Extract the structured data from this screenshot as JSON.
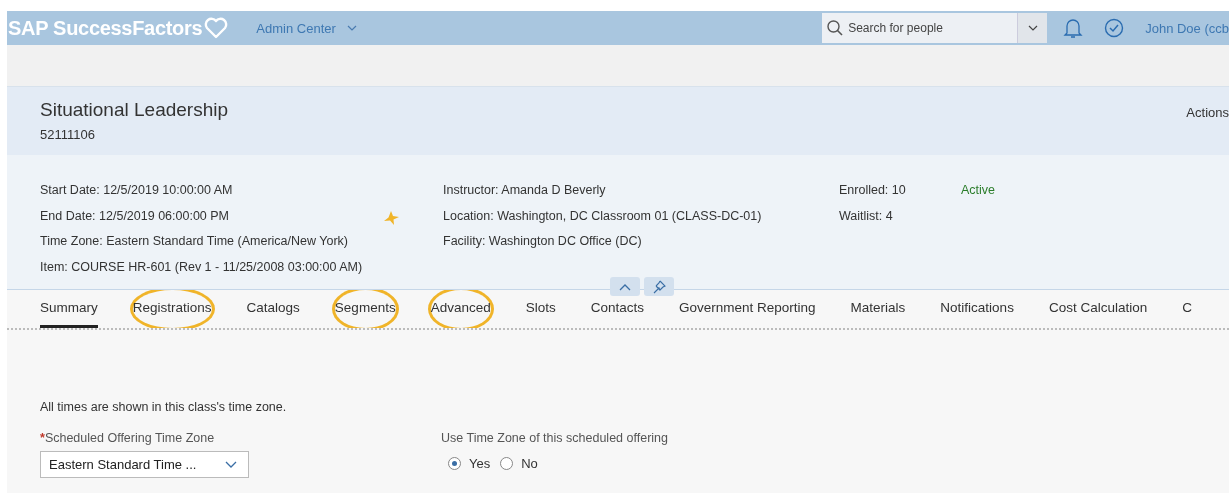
{
  "header": {
    "logo": "SAP SuccessFactors",
    "module": "Admin Center",
    "search": {
      "placeholder": "Search for people"
    },
    "user": "John Doe (ccb"
  },
  "title_panel": {
    "title": "Situational Leadership",
    "id": "52111106",
    "actions": "Actions"
  },
  "details": {
    "columns": [
      [
        "Start Date: 12/5/2019 10:00:00 AM",
        "End Date: 12/5/2019 06:00:00 PM",
        "Time Zone: Eastern Standard Time (America/New York)",
        "Item: COURSE HR-601 (Rev 1 - 11/25/2008 03:00:00 AM)"
      ],
      [
        "Instructor: Amanda D Beverly",
        "Location: Washington, DC Classroom 01 (CLASS-DC-01)",
        "Facility: Washington DC Office (DC)"
      ],
      [
        "Enrolled: 10",
        "Waitlist: 4"
      ]
    ],
    "status": {
      "text": "Active",
      "kind": "active"
    }
  },
  "tabs": [
    {
      "label": "Summary",
      "selected": true,
      "highlighted": false
    },
    {
      "label": "Registrations",
      "selected": false,
      "highlighted": true
    },
    {
      "label": "Catalogs",
      "selected": false,
      "highlighted": false
    },
    {
      "label": "Segments",
      "selected": false,
      "highlighted": true
    },
    {
      "label": "Advanced",
      "selected": false,
      "highlighted": true
    },
    {
      "label": "Slots",
      "selected": false,
      "highlighted": false
    },
    {
      "label": "Contacts",
      "selected": false,
      "highlighted": false
    },
    {
      "label": "Government Reporting",
      "selected": false,
      "highlighted": false
    },
    {
      "label": "Materials",
      "selected": false,
      "highlighted": false
    },
    {
      "label": "Notifications",
      "selected": false,
      "highlighted": false
    },
    {
      "label": "Cost Calculation",
      "selected": false,
      "highlighted": false
    },
    {
      "label": "C",
      "selected": false,
      "highlighted": false
    }
  ],
  "content": {
    "note": "All times are shown in this class's time zone.",
    "time_zone": {
      "required_mark": "*",
      "label": "Scheduled Offering Time Zone",
      "value": "Eastern Standard Time ..."
    },
    "use_time_zone": {
      "label": "Use Time Zone of this scheduled offering",
      "options": [
        {
          "label": "Yes",
          "selected": true
        },
        {
          "label": "No",
          "selected": false
        }
      ]
    }
  }
}
